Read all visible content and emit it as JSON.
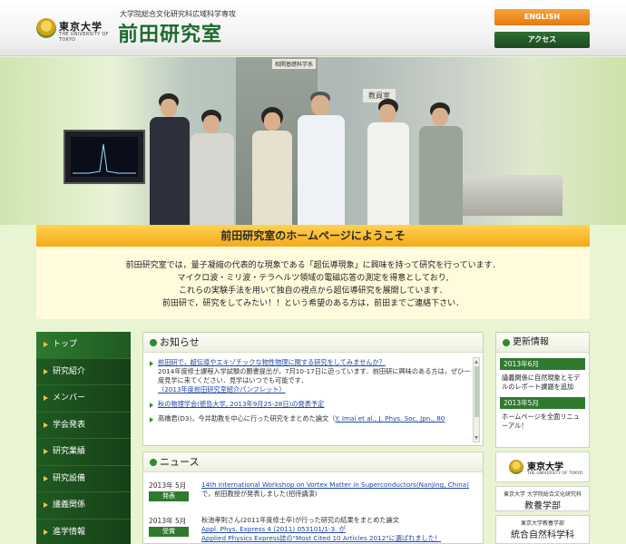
{
  "header": {
    "logo_ja": "東京大学",
    "logo_en": "THE UNIVERSITY OF TOKYO",
    "department": "大学院総合文化研究科広域科学専攻",
    "lab_title": "前田研究室",
    "english_button": "ENGLISH",
    "access_button": "アクセス"
  },
  "hero": {
    "sign_top": "相関基礎科学系",
    "sign_mid": "教員室"
  },
  "welcome": {
    "heading": "前田研究室のホームページにようこそ",
    "lines": [
      "前田研究室では，量子凝縮の代表的な現象である「超伝導現象」に興味を持って研究を行っています．",
      "マイクロ波・ミリ波・テラヘルツ領域の電磁応答の測定を得意としており,",
      "これらの実験手法を用いて独自の視点から超伝導研究を展開しています．",
      "前田研で，研究をしてみたい！！という希望のある方は，前田までご連絡下さい．"
    ]
  },
  "nav": {
    "items": [
      "トップ",
      "研究紹介",
      "メンバー",
      "学会発表",
      "研究業績",
      "研究設備",
      "議義関係",
      "進学情報"
    ]
  },
  "notice": {
    "title": "お知らせ",
    "items": [
      {
        "link": "前田研で，超伝導やエキゾチックな物性物理に関する研究をしてみませんか？",
        "text": "2014年度修士課程入学試験の願書提出が，7月10-17日に迫っています．前田研に興味のある方は，ぜひ一度見学に来てください．見学はいつでも可能です．",
        "link2": "（2013年度前田研究室紹介パンフレット）"
      },
      {
        "link": "秋の物理学会(徳島大学, 2013年9月25-28日)の発表予定",
        "text": "",
        "link2": ""
      },
      {
        "link": "",
        "text": "高橋君(D3)，今井助教を中心に行った研究をまとめた論文（",
        "link2": "Y. Imai et al., J. Phys. Soc. Jpn., 80"
      }
    ]
  },
  "news": {
    "title": "ニュース",
    "items": [
      {
        "date": "2013年 5月",
        "badge": "発表",
        "link": "14th International Workshop on Vortex Matter in Superconductors(Nanjing, China)",
        "text": "で，前田教授が発表しました(招待講演)"
      },
      {
        "date": "2013年 5月",
        "badge": "受賞",
        "lines": [
          "秋池孝則さん(2011年度修士卒)が行った研究の結果をまとめた論文",
          "Appl. Phys. Express 4 (2011) 053101/1-3. が",
          "Applied Physics Express誌の\"Most Cited 10 Articles 2012\"に選ばれました！"
        ]
      }
    ]
  },
  "updates": {
    "title": "更新情報",
    "items": [
      {
        "month": "2013年6月",
        "text": "議義関係に自然現象とモデルのレポート課題を追加"
      },
      {
        "month": "2013年5月",
        "text": "ホームページを全面リニューアル！"
      }
    ]
  },
  "banners": {
    "utokyo_ja": "東京大学",
    "utokyo_en": "THE UNIVERSITY OF TOKYO",
    "b2_small": "東京大学 大学院総合文化研究科",
    "b2_big": "教養学部",
    "b3_small": "東京大学教養学部",
    "b3_big": "統合自然科学科"
  }
}
